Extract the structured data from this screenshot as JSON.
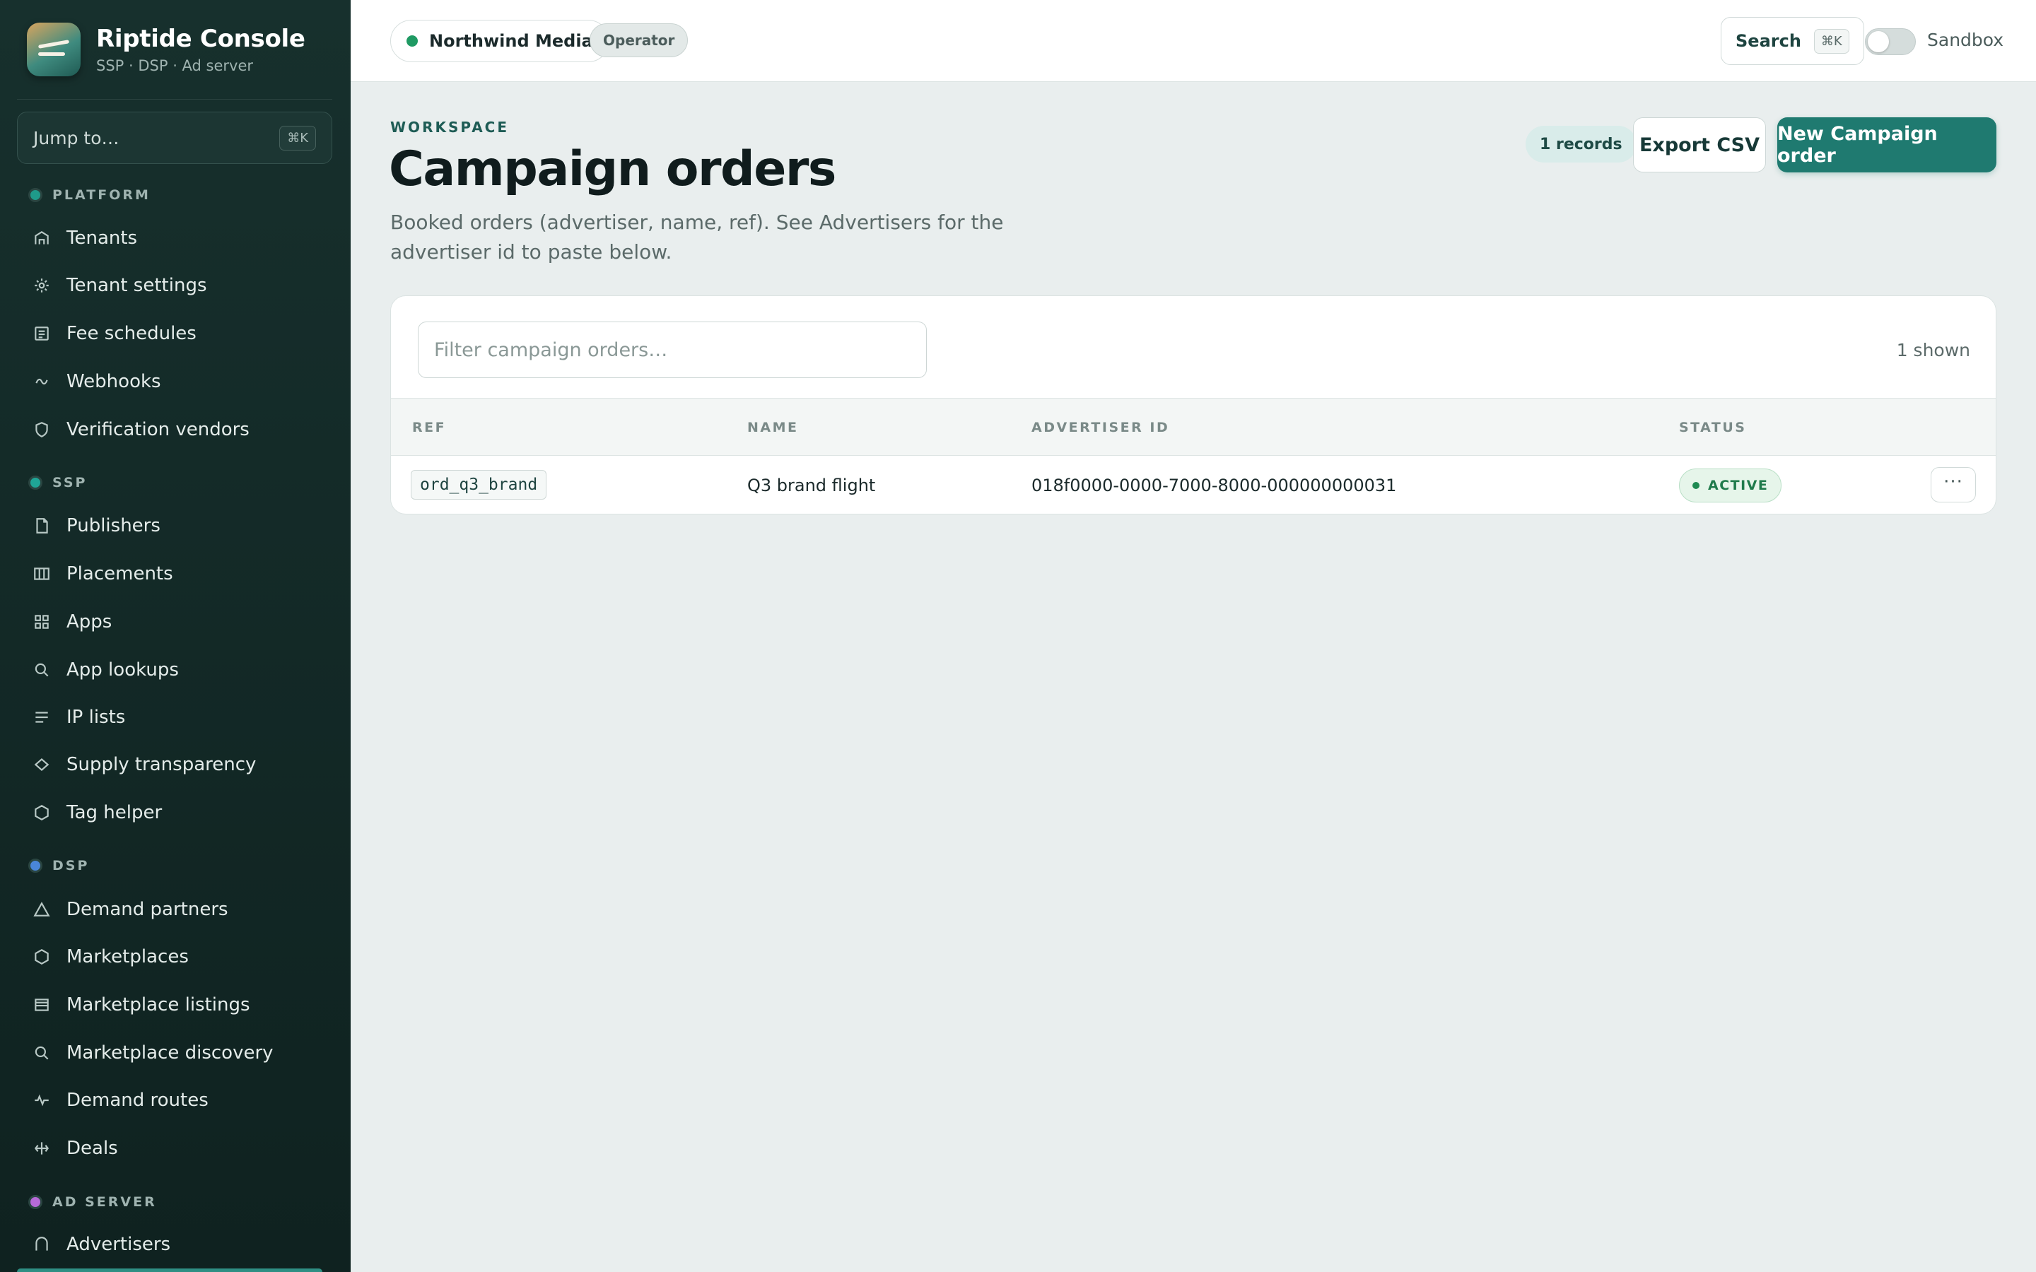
{
  "brand": {
    "name": "Riptide Console",
    "subtitle": "SSP · DSP · Ad server"
  },
  "jump": {
    "placeholder": "Jump to…",
    "shortcut": "⌘K"
  },
  "sections": {
    "platform": {
      "label": "PLATFORM",
      "color": "#1f9a8a"
    },
    "ssp": {
      "label": "SSP",
      "color": "#1fa596"
    },
    "dsp": {
      "label": "DSP",
      "color": "#4a86d9"
    },
    "adserver": {
      "label": "AD SERVER",
      "color": "#b66ad8"
    }
  },
  "nav": {
    "platform": [
      {
        "label": "Tenants",
        "icon": "home-icon"
      },
      {
        "label": "Tenant settings",
        "icon": "gear-icon"
      },
      {
        "label": "Fee schedules",
        "icon": "receipt-icon"
      },
      {
        "label": "Webhooks",
        "icon": "webhook-icon"
      },
      {
        "label": "Verification vendors",
        "icon": "shield-icon"
      }
    ],
    "ssp": [
      {
        "label": "Publishers",
        "icon": "file-icon"
      },
      {
        "label": "Placements",
        "icon": "columns-icon"
      },
      {
        "label": "Apps",
        "icon": "grid-icon"
      },
      {
        "label": "App lookups",
        "icon": "search-icon"
      },
      {
        "label": "IP lists",
        "icon": "list-icon"
      },
      {
        "label": "Supply transparency",
        "icon": "diamond-icon"
      },
      {
        "label": "Tag helper",
        "icon": "hexagon-icon"
      }
    ],
    "dsp": [
      {
        "label": "Demand partners",
        "icon": "triangle-icon"
      },
      {
        "label": "Marketplaces",
        "icon": "hexagon-icon"
      },
      {
        "label": "Marketplace listings",
        "icon": "listing-icon"
      },
      {
        "label": "Marketplace discovery",
        "icon": "search-icon"
      },
      {
        "label": "Demand routes",
        "icon": "pulse-icon"
      },
      {
        "label": "Deals",
        "icon": "handshake-icon"
      }
    ],
    "adserver": [
      {
        "label": "Advertisers",
        "icon": "home-icon"
      }
    ]
  },
  "topbar": {
    "tenant": "Northwind Media",
    "role": "Operator",
    "search_label": "Search",
    "search_shortcut": "⌘K",
    "sandbox_label": "Sandbox",
    "sandbox_on": false
  },
  "page": {
    "eyebrow": "WORKSPACE",
    "title": "Campaign orders",
    "description": "Booked orders (advertiser, name, ref). See Advertisers for the advertiser id to paste below.",
    "records_badge": "1 records",
    "export_label": "Export CSV",
    "new_label": "New Campaign order"
  },
  "table": {
    "filter_placeholder": "Filter campaign orders…",
    "shown_count": "1 shown",
    "columns": [
      "REF",
      "NAME",
      "ADVERTISER ID",
      "STATUS"
    ],
    "rows": [
      {
        "ref": "ord_q3_brand",
        "name": "Q3 brand flight",
        "advertiser_id": "018f0000-0000-7000-8000-000000000031",
        "status": "ACTIVE",
        "actions": "···"
      }
    ]
  }
}
